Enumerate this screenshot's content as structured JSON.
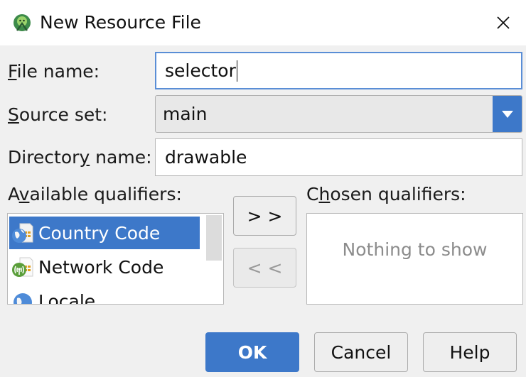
{
  "window": {
    "title": "New Resource File",
    "close_label": "✕"
  },
  "form": {
    "file_name": {
      "label_prefix": "",
      "label_mnemonic": "F",
      "label_rest": "ile name:",
      "value": "selector"
    },
    "source_set": {
      "label_prefix": "",
      "label_mnemonic": "S",
      "label_rest": "ource set:",
      "value": "main"
    },
    "directory_name": {
      "label_prefix": "Director",
      "label_mnemonic": "y",
      "label_rest": " name:",
      "value": "drawable"
    }
  },
  "qualifiers": {
    "available_label": {
      "prefix": "A",
      "mnemonic": "v",
      "rest": "ailable qualifiers:"
    },
    "chosen_label": {
      "prefix": "C",
      "mnemonic": "h",
      "rest": "osen qualifiers:"
    },
    "available_items": [
      "Country Code",
      "Network Code",
      "Locale"
    ],
    "selected_index": 0,
    "add_button": "> >",
    "remove_button": "< <",
    "chosen_empty_text": "Nothing to show"
  },
  "buttons": {
    "ok": "OK",
    "cancel": "Cancel",
    "help": "Help"
  },
  "colors": {
    "accent": "#3d78c9",
    "focus_border": "#5a8ed6",
    "background": "#f0f0f0"
  },
  "icons": {
    "app": "android-studio-icon",
    "country_code": "globe-sim-icon",
    "network_code": "antenna-sim-icon",
    "locale": "globe-icon"
  }
}
